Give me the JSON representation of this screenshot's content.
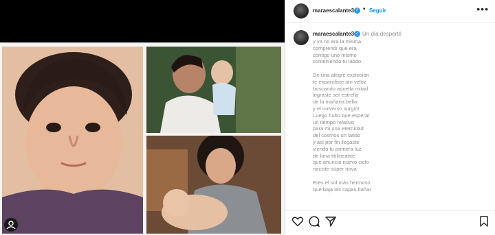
{
  "post": {
    "username": "maraescalante3",
    "follow_label": "Seguir",
    "more_label": "•••",
    "caption_first_line": "Un día desperté",
    "caption_lines": [
      "y ya no era la misma",
      "comprendí que era",
      "contigo uno mismo",
      "conteniendo tu latido",
      "",
      "De una alegre explosión",
      "te expandiste tan veloz",
      "buscando aquella mitad",
      "lograste ser estrella",
      "de la mañana bella",
      "y el universo surgió!",
      "Luego hubo que esperar",
      "un tiempo relativo",
      "para mi una eternidad",
      "del cosmos un latido",
      "y así por fin llegaste",
      "viendo tu primera luz",
      "de luna titilineante",
      "que anuncia nuevo ciclo",
      "naciste súper nova",
      "",
      "Eres el sol más hermoso",
      "que baja las capas bañar"
    ]
  },
  "icons": {
    "like": "heart-icon",
    "comment": "comment-icon",
    "share": "share-icon",
    "save": "bookmark-icon",
    "verified": "verified-badge-icon",
    "media_tag": "user-tag-icon"
  },
  "colors": {
    "link": "#0095f6",
    "verified": "#3897f0",
    "text": "#262626",
    "muted": "#8e8e8e"
  }
}
